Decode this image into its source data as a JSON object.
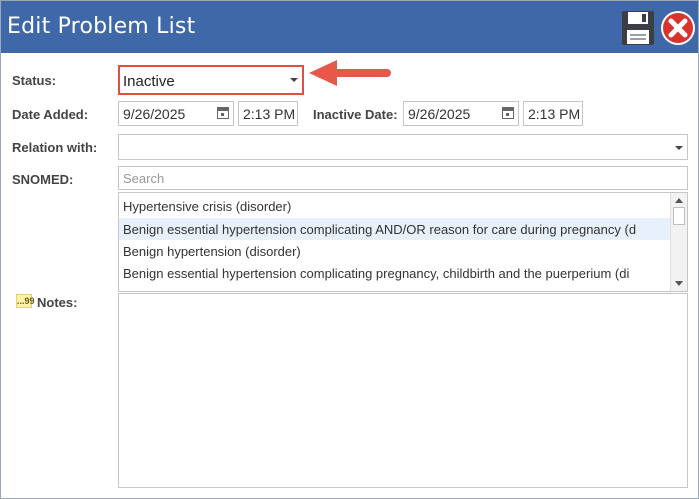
{
  "window": {
    "title": "Edit Problem List"
  },
  "toolbar": {
    "save_icon": "floppy-disk-icon",
    "close_icon": "close-x-icon"
  },
  "labels": {
    "status": "Status:",
    "date_added": "Date Added:",
    "inactive_date": "Inactive Date:",
    "relation_with": "Relation with:",
    "snomed": "SNOMED:",
    "notes": "Notes:"
  },
  "status": {
    "value": "Inactive"
  },
  "date_added": {
    "date": "9/26/2025",
    "time": "2:13 PM"
  },
  "inactive_date": {
    "date": "9/26/2025",
    "time": "2:13 PM"
  },
  "relation_with": {
    "value": ""
  },
  "snomed": {
    "placeholder": "Search",
    "results": [
      "Hypertensive crisis (disorder)",
      "Benign essential hypertension complicating AND/OR reason for care during pregnancy (d",
      "Benign hypertension (disorder)",
      "Benign essential hypertension complicating pregnancy, childbirth and the puerperium (di"
    ]
  },
  "notes": {
    "value": "",
    "icon_text": "...99"
  },
  "colors": {
    "titlebar": "#3f68a8",
    "highlight_border": "#e0503c",
    "arrow": "#e8584a",
    "close_red": "#d9342b"
  }
}
